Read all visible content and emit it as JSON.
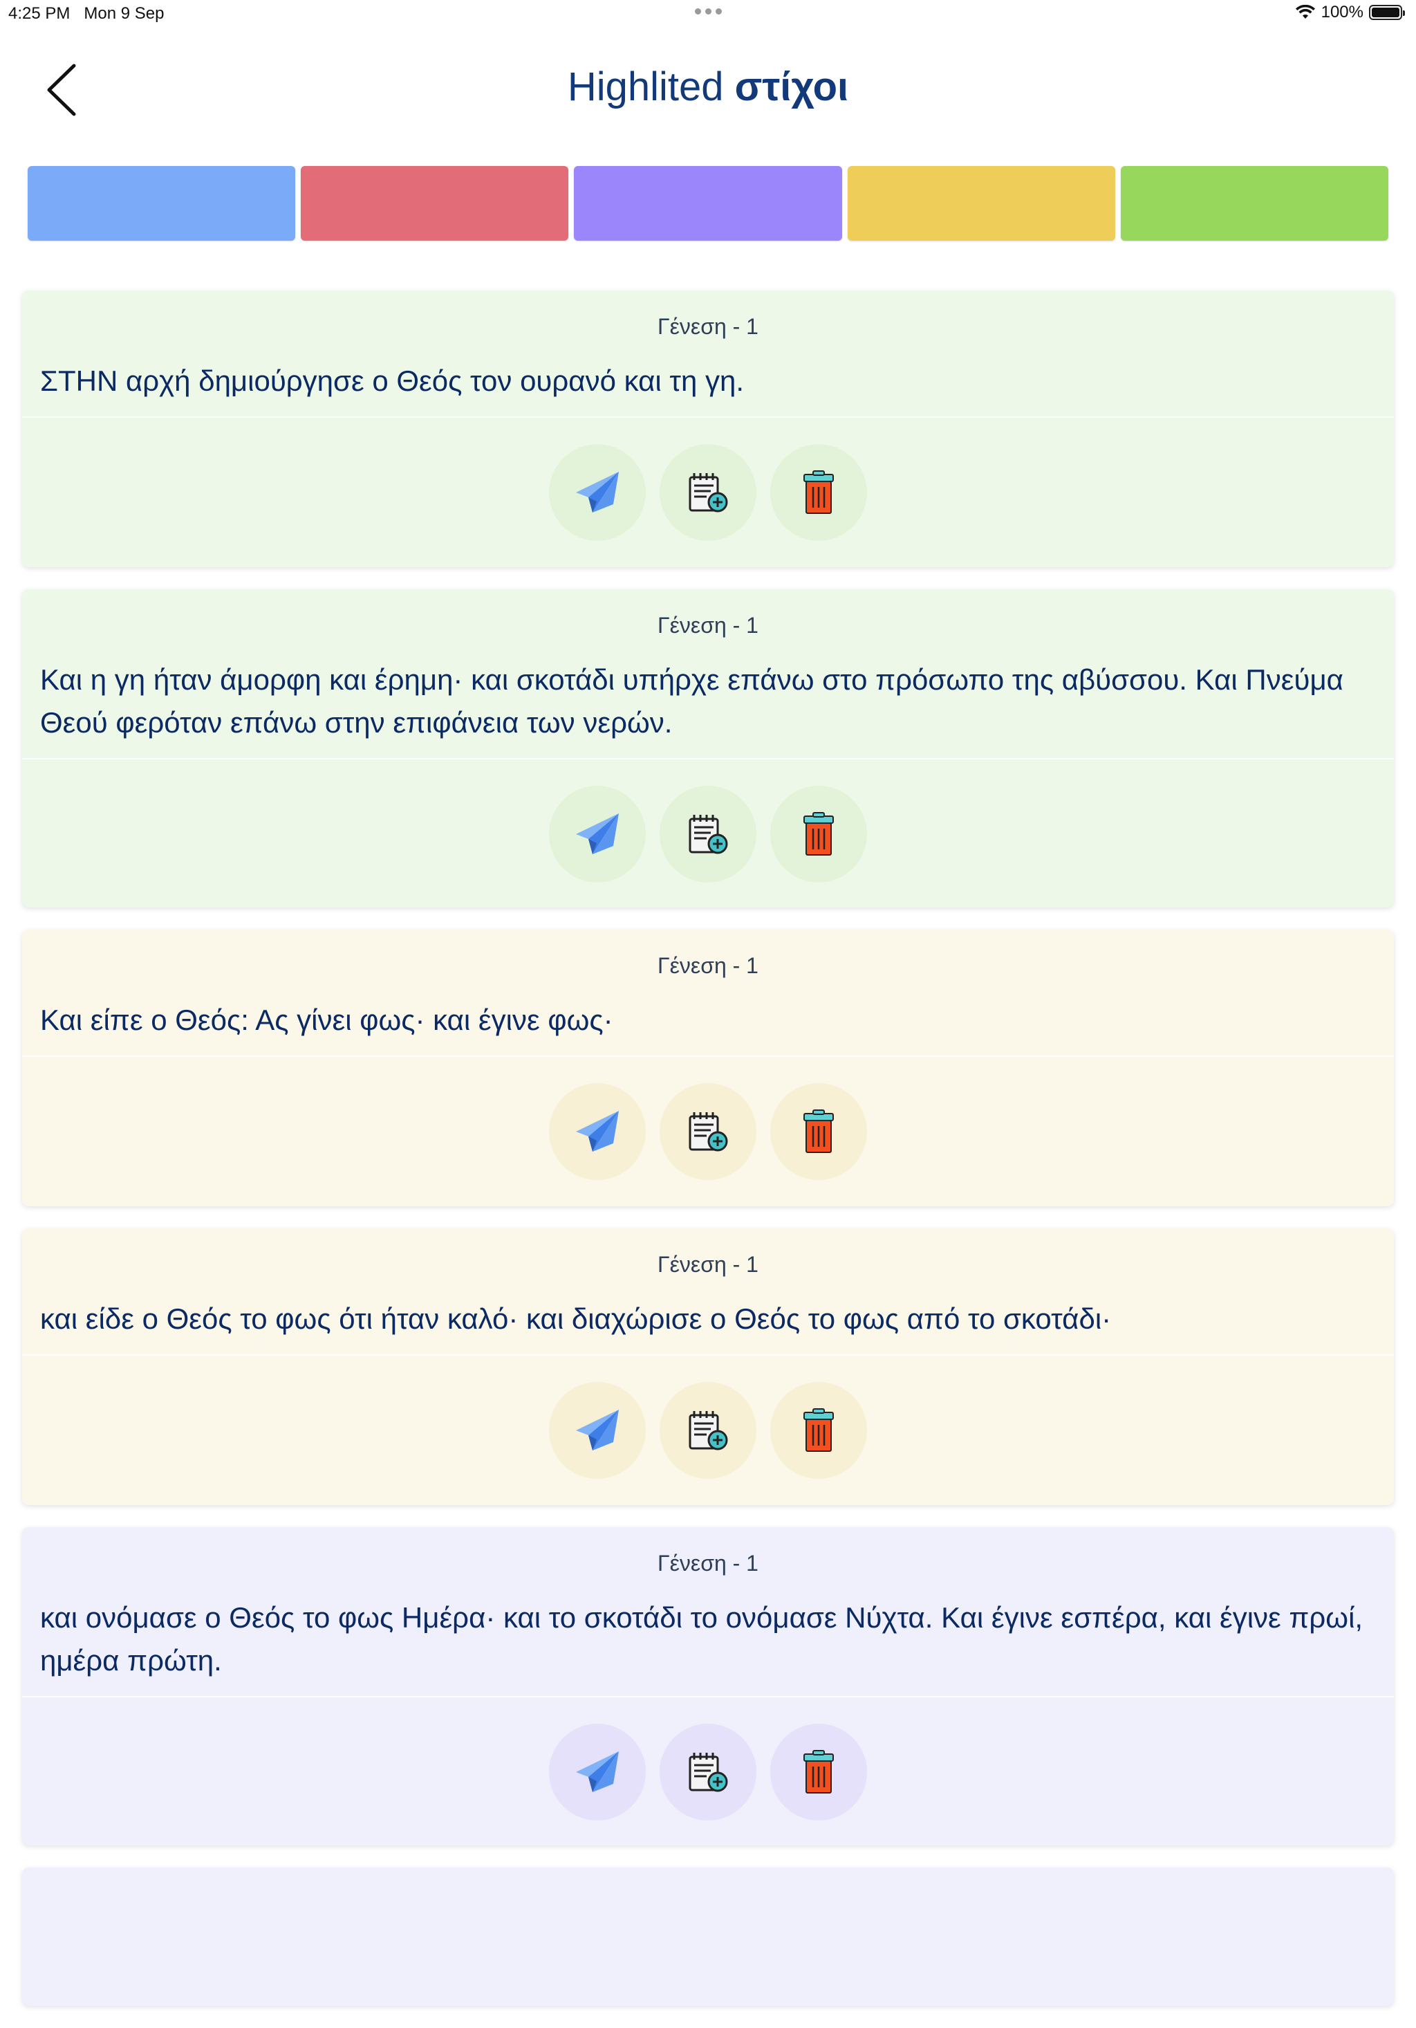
{
  "status": {
    "time": "4:25 PM",
    "date": "Mon 9 Sep",
    "battery": "100%"
  },
  "header": {
    "title_part1": "Highlited",
    "title_part2": "στίχοι"
  },
  "colors": [
    "#7aaaf8",
    "#e26d79",
    "#9c86fb",
    "#efcd59",
    "#97d85c"
  ],
  "cards": [
    {
      "ref": "Γένεση - 1",
      "text": "ΣΤΗΝ αρχή δημιούργησε ο Θεός τον ουρανό και τη γη.",
      "theme": "green"
    },
    {
      "ref": "Γένεση - 1",
      "text": "Και η γη ήταν άμορφη και έρημη· και σκοτάδι υπήρχε επάνω στο πρόσωπο της αβύσσου. Και Πνεύμα Θεού φερόταν επάνω στην επιφάνεια των νερών.",
      "theme": "green"
    },
    {
      "ref": "Γένεση - 1",
      "text": "Και είπε ο Θεός: Ας γίνει φως· και έγινε φως·",
      "theme": "yellow"
    },
    {
      "ref": "Γένεση - 1",
      "text": "και είδε ο Θεός το φως ότι ήταν καλό· και διαχώρισε ο Θεός το φως από το σκοτάδι·",
      "theme": "yellow"
    },
    {
      "ref": "Γένεση - 1",
      "text": "και ονόμασε ο Θεός το φως Ημέρα· και το σκοτάδι το ονόμασε Νύχτα. Και έγινε εσπέρα, και έγινε πρωί, ημέρα πρώτη.",
      "theme": "purple"
    }
  ],
  "icons": {
    "back": "chevron-left-icon",
    "share": "paper-plane-icon",
    "note": "add-note-icon",
    "delete": "trash-icon"
  }
}
